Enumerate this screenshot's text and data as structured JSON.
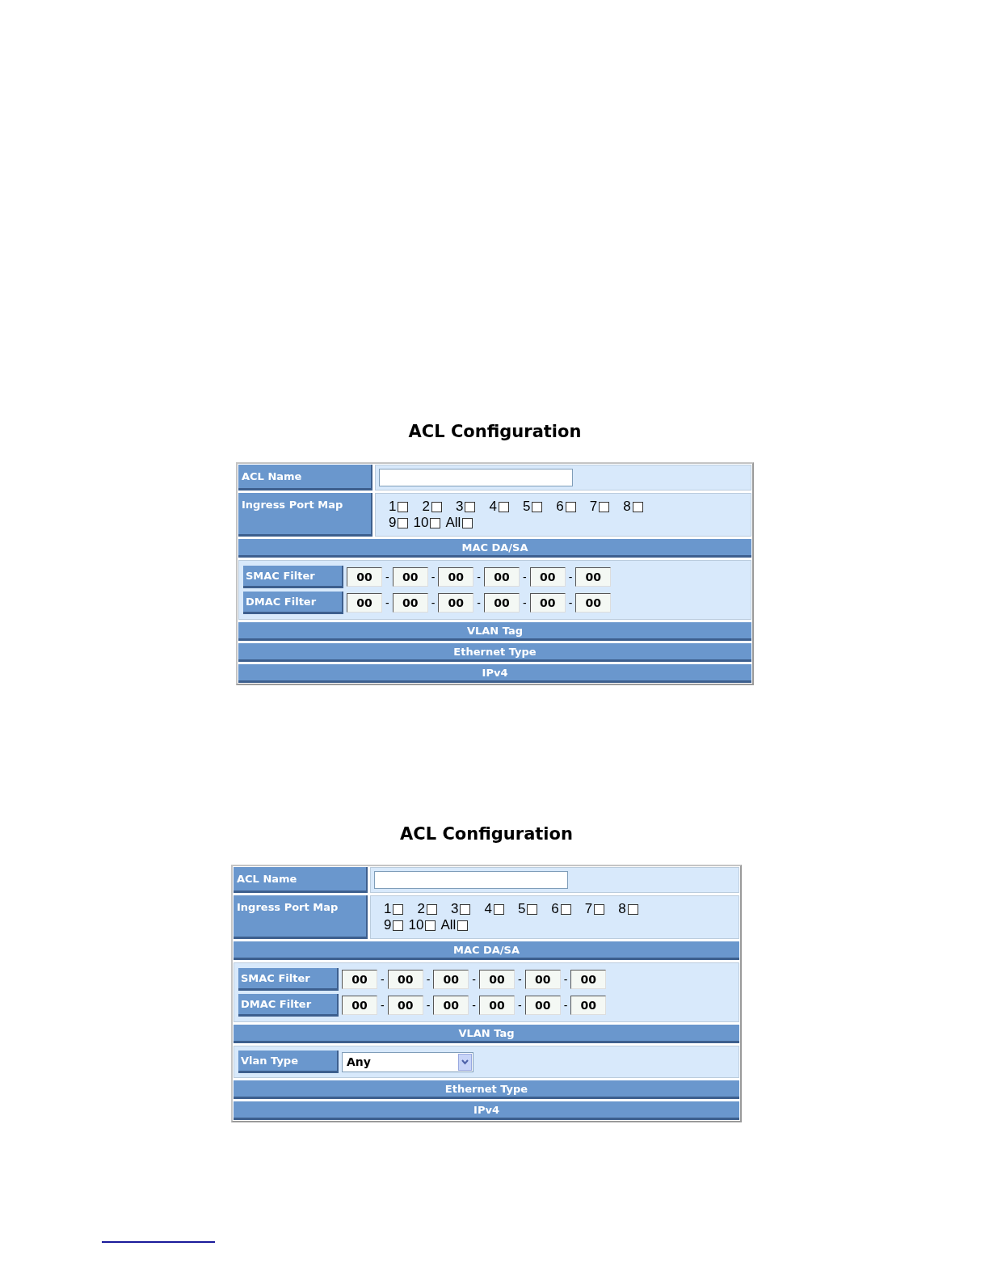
{
  "panels": [
    {
      "title": "ACL Configuration",
      "rows": [
        {
          "kind": "name_field",
          "label": "ACL Name"
        },
        {
          "kind": "ports",
          "label": "Ingress Port Map",
          "ports": [
            {
              "label": "1",
              "checked": false
            },
            {
              "label": "2",
              "checked": false
            },
            {
              "label": "3",
              "checked": false
            },
            {
              "label": "4",
              "checked": false
            },
            {
              "label": "5",
              "checked": false
            },
            {
              "label": "6",
              "checked": false
            },
            {
              "label": "7",
              "checked": false
            },
            {
              "label": "8",
              "checked": false
            },
            {
              "label": "9",
              "checked": false
            },
            {
              "label": "10",
              "checked": false
            },
            {
              "label": "All",
              "checked": false
            }
          ]
        },
        {
          "kind": "header",
          "label": "MAC DA/SA"
        },
        {
          "kind": "mac_filters",
          "filters": [
            {
              "label": "SMAC Filter",
              "separator": "-",
              "octets": [
                "00",
                "00",
                "00",
                "00",
                "00",
                "00"
              ]
            },
            {
              "label": "DMAC Filter",
              "separator": "-",
              "octets": [
                "00",
                "00",
                "00",
                "00",
                "00",
                "00"
              ]
            }
          ]
        },
        {
          "kind": "header",
          "label": "VLAN Tag"
        },
        {
          "kind": "header",
          "label": "Ethernet Type"
        },
        {
          "kind": "header",
          "label": "IPv4"
        }
      ]
    },
    {
      "title": "ACL Configuration",
      "rows": [
        {
          "kind": "name_field",
          "label": "ACL Name"
        },
        {
          "kind": "ports",
          "label": "Ingress Port Map",
          "ports": [
            {
              "label": "1",
              "checked": false
            },
            {
              "label": "2",
              "checked": false
            },
            {
              "label": "3",
              "checked": false
            },
            {
              "label": "4",
              "checked": false
            },
            {
              "label": "5",
              "checked": false
            },
            {
              "label": "6",
              "checked": false
            },
            {
              "label": "7",
              "checked": false
            },
            {
              "label": "8",
              "checked": false
            },
            {
              "label": "9",
              "checked": false
            },
            {
              "label": "10",
              "checked": false
            },
            {
              "label": "All",
              "checked": false
            }
          ]
        },
        {
          "kind": "header",
          "label": "MAC DA/SA"
        },
        {
          "kind": "mac_filters",
          "filters": [
            {
              "label": "SMAC Filter",
              "separator": "-",
              "octets": [
                "00",
                "00",
                "00",
                "00",
                "00",
                "00"
              ]
            },
            {
              "label": "DMAC Filter",
              "separator": "-",
              "octets": [
                "00",
                "00",
                "00",
                "00",
                "00",
                "00"
              ]
            }
          ]
        },
        {
          "kind": "header",
          "label": "VLAN Tag"
        },
        {
          "kind": "select",
          "label": "Vlan Type",
          "value": "Any"
        },
        {
          "kind": "header",
          "label": "Ethernet Type"
        },
        {
          "kind": "header",
          "label": "IPv4"
        }
      ]
    }
  ]
}
